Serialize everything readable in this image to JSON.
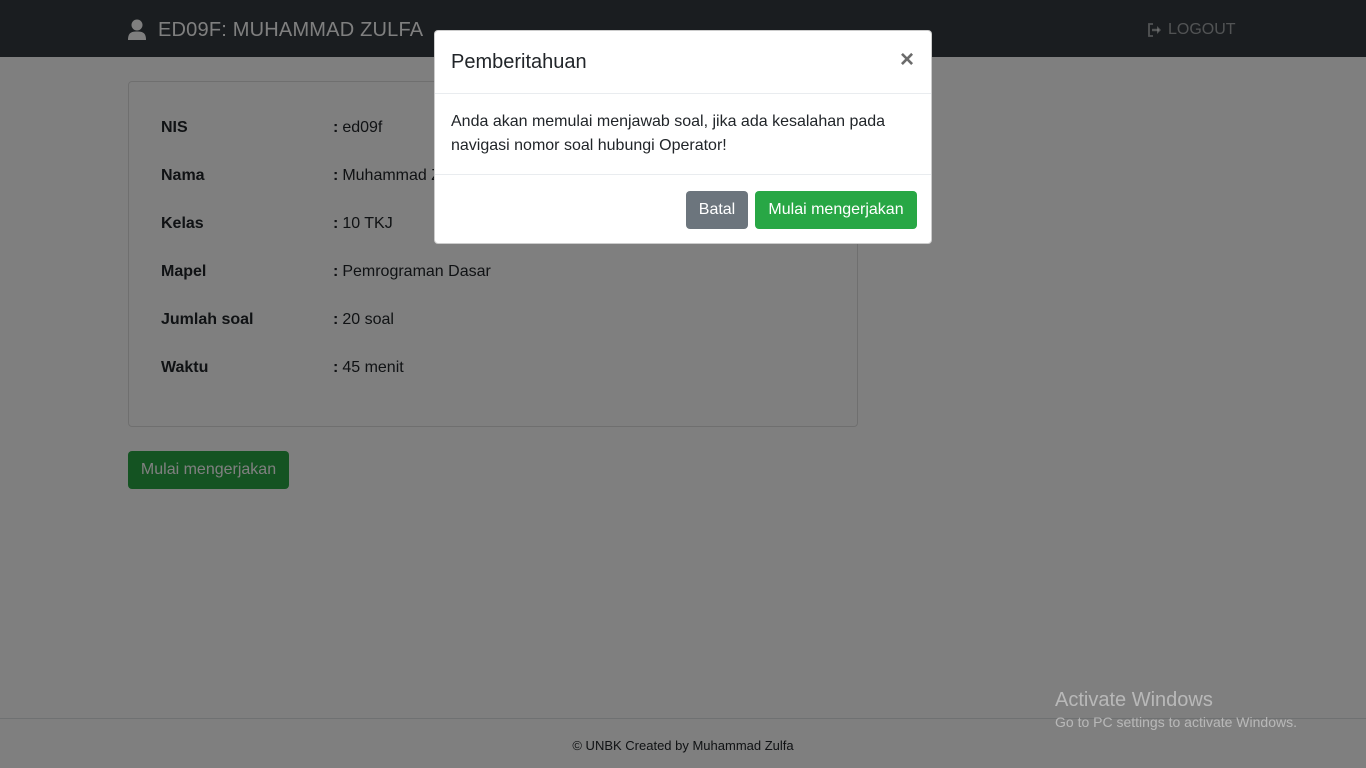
{
  "navbar": {
    "brand": "ED09F: MUHAMMAD ZULFA",
    "user_icon": "user-icon",
    "logout_icon": "sign-out-icon",
    "logout_label": "LOGOUT"
  },
  "info": {
    "rows": [
      {
        "label": "NIS",
        "value": "ed09f"
      },
      {
        "label": "Nama",
        "value": "Muhammad Zulfa"
      },
      {
        "label": "Kelas",
        "value": "10 TKJ"
      },
      {
        "label": "Mapel",
        "value": "Pemrograman Dasar"
      },
      {
        "label": "Jumlah soal",
        "value": "20 soal"
      },
      {
        "label": "Waktu",
        "value": "45 menit"
      }
    ],
    "start_button": "Mulai mengerjakan"
  },
  "footer": {
    "text": "© UNBK Created by Muhammad Zulfa"
  },
  "modal": {
    "title": "Pemberitahuan",
    "close": "×",
    "body": "Anda akan memulai menjawab soal, jika ada kesalahan pada navigasi nomor soal hubungi Operator!",
    "cancel_label": "Batal",
    "confirm_label": "Mulai mengerjakan"
  },
  "watermark": {
    "line1": "Activate Windows",
    "line2": "Go to PC settings to activate Windows."
  },
  "colors": {
    "navbar": "#343a40",
    "success": "#28a745",
    "secondary": "#6c757d"
  }
}
